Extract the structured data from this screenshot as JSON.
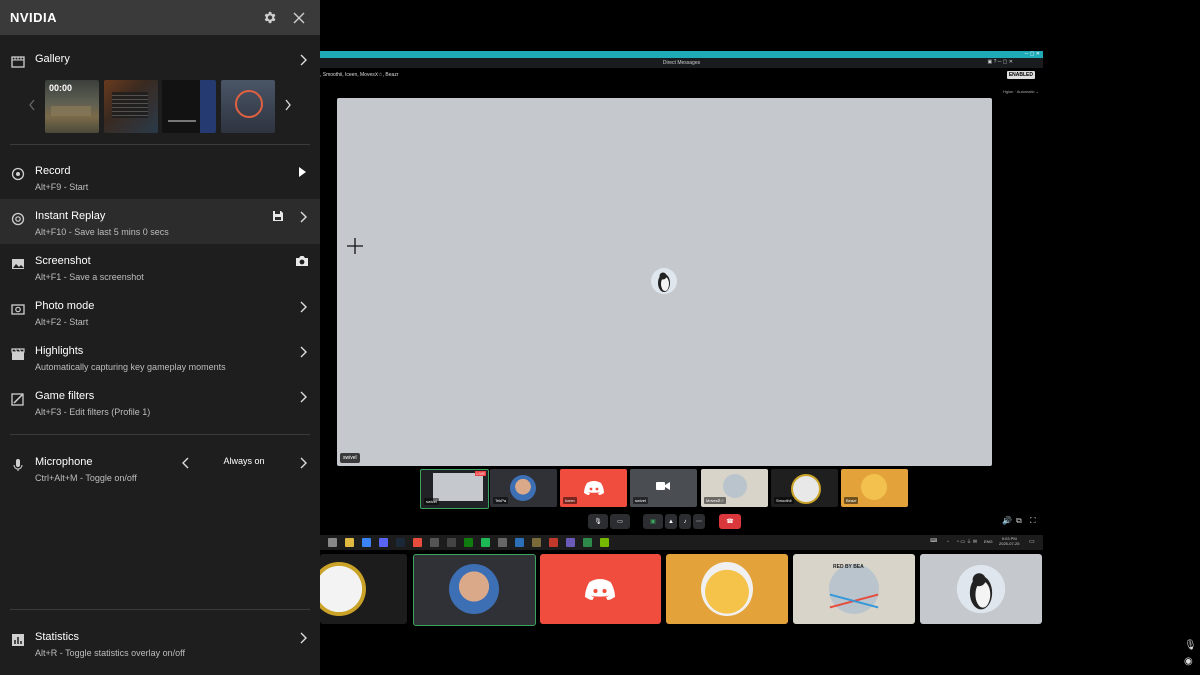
{
  "overlay": {
    "title": "NVIDIA",
    "gallery": {
      "label": "Gallery",
      "thumb_time": "00:00"
    },
    "record": {
      "label": "Record",
      "shortcut": "Alt+F9 - Start"
    },
    "instant_replay": {
      "label": "Instant Replay",
      "shortcut": "Alt+F10 - Save last 5 mins 0 secs"
    },
    "screenshot": {
      "label": "Screenshot",
      "shortcut": "Alt+F1 - Save a screenshot"
    },
    "photo_mode": {
      "label": "Photo mode",
      "shortcut": "Alt+F2 - Start"
    },
    "highlights": {
      "label": "Highlights",
      "description": "Automatically capturing key gameplay moments"
    },
    "game_filters": {
      "label": "Game filters",
      "shortcut": "Alt+F3 - Edit filters (Profile 1)"
    },
    "microphone": {
      "label": "Microphone",
      "shortcut": "Ctrl+Alt+M - Toggle on/off",
      "value": "Always on"
    },
    "statistics": {
      "label": "Statistics",
      "shortcut": "Alt+R - Toggle statistics overlay on/off"
    }
  },
  "discord": {
    "window_title": "Direct Messages",
    "participants_header": ", Smoothii, Iceen, MovesⅩ☆, Beazr",
    "enabled_badge": "ENABLED",
    "stage_name_tag": "swivel",
    "stage_options": "Hgion · Automatic ⌄",
    "strip": [
      {
        "name": "swivel",
        "live": "LIVE"
      },
      {
        "name": "TekPa"
      },
      {
        "name": "Iceen"
      },
      {
        "name": "swivel"
      },
      {
        "name": "MovesⅩ☆"
      },
      {
        "name": "Smoothii"
      },
      {
        "name": "Beazr"
      }
    ],
    "colors": {
      "accent": "#1faab8",
      "discord_red": "#f04d3e",
      "stage": "#c5c9cd",
      "hangup": "#da373c"
    }
  },
  "taskbar": {
    "lang": "ENG",
    "time": "9:03 PM",
    "date": "2025-07-25"
  },
  "bottom_tiles_text": "RED BY BEA"
}
